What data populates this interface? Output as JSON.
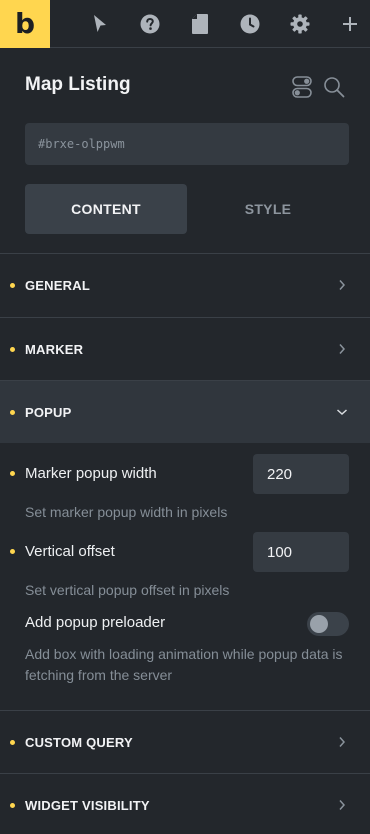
{
  "toolbar": {
    "logo": "b",
    "icons": [
      "cursor-icon",
      "help-icon",
      "page-icon",
      "history-icon",
      "gear-icon",
      "plus-icon"
    ]
  },
  "header": {
    "title": "Map Listing",
    "element_id_placeholder": "#brxe-olppwm"
  },
  "tabs": {
    "content": "CONTENT",
    "style": "STYLE",
    "active": "content"
  },
  "sections": {
    "general": "GENERAL",
    "marker": "MARKER",
    "popup": "POPUP",
    "custom_query": "CUSTOM QUERY",
    "widget_visibility": "WIDGET VISIBILITY"
  },
  "popup": {
    "width_label": "Marker popup width",
    "width_value": "220",
    "width_desc": "Set marker popup width in pixels",
    "offset_label": "Vertical offset",
    "offset_value": "100",
    "offset_desc": "Set vertical popup offset in pixels",
    "preloader_label": "Add popup preloader",
    "preloader_enabled": false,
    "preloader_desc": "Add box with loading animation while popup data is fetching from the server"
  },
  "colors": {
    "accent": "#ffd64f",
    "panel_bg": "#23272c"
  }
}
